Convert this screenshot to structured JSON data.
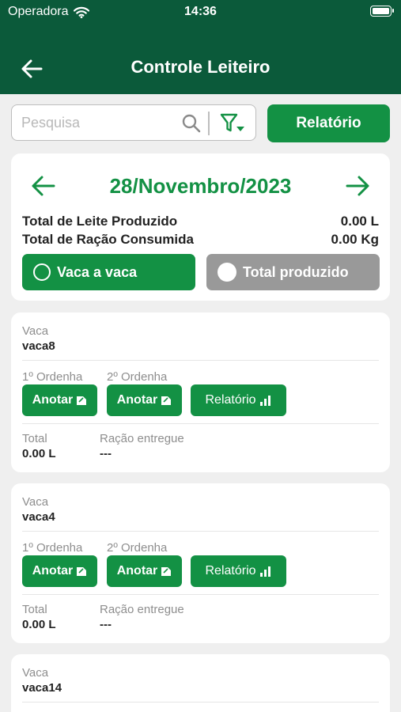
{
  "status": {
    "carrier": "Operadora",
    "time": "14:36"
  },
  "header": {
    "title": "Controle Leiteiro"
  },
  "search": {
    "placeholder": "Pesquisa",
    "report_label": "Relatório"
  },
  "summary": {
    "date": "28/Novembro/2023",
    "milk_label": "Total de Leite Produzido",
    "milk_value": "0.00 L",
    "feed_label": "Total de Ração Consumida",
    "feed_value": "0.00 Kg",
    "mode_per_cow": "Vaca a vaca",
    "mode_total": "Total produzido"
  },
  "cows": [
    {
      "cow_label": "Vaca",
      "name": "vaca8",
      "milking1_label": "1º Ordenha",
      "milking2_label": "2º Ordenha",
      "annotate_label": "Anotar",
      "report_label": "Relatório",
      "total_label": "Total",
      "total_value": "0.00 L",
      "feed_label": "Ração entregue",
      "feed_value": "---"
    },
    {
      "cow_label": "Vaca",
      "name": "vaca4",
      "milking1_label": "1º Ordenha",
      "milking2_label": "2º Ordenha",
      "annotate_label": "Anotar",
      "report_label": "Relatório",
      "total_label": "Total",
      "total_value": "0.00 L",
      "feed_label": "Ração entregue",
      "feed_value": "---"
    },
    {
      "cow_label": "Vaca",
      "name": "vaca14"
    }
  ],
  "colors": {
    "header": "#0b5a3a",
    "accent": "#139144",
    "inactive": "#999999",
    "background": "#efefef"
  },
  "icons": [
    "wifi-icon",
    "battery-icon",
    "back-arrow-icon",
    "search-icon",
    "filter-icon",
    "prev-date-icon",
    "next-date-icon",
    "radio-icon",
    "edit-note-icon",
    "bar-chart-icon"
  ]
}
